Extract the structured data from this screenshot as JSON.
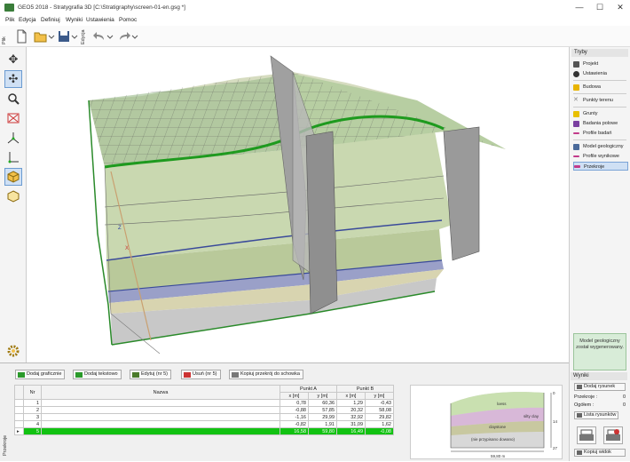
{
  "window": {
    "title": "GEO5 2018 - Stratygrafia 3D [C:\\Stratigraphy\\screen-01-en.gsg *]",
    "minimize": "—",
    "maximize": "☐",
    "close": "✕"
  },
  "menu": [
    "Plik",
    "Edycja",
    "Definiuj",
    "Wyniki",
    "Ustawienia",
    "Pomoc"
  ],
  "toolbar": {
    "tab_file": "Plik",
    "tab_edit": "Edycja"
  },
  "modes": {
    "header": "Tryby",
    "items": [
      {
        "label": "Projekt",
        "color": "#555555"
      },
      {
        "label": "Ustawienia",
        "color": "#333333"
      },
      {
        "label": "Budowa",
        "color": "#e8b400"
      },
      {
        "label": "Punkty terenu",
        "color": "#888888"
      },
      {
        "label": "Grunty",
        "color": "#e8c000"
      },
      {
        "label": "Badania polowe",
        "color": "#7a3fa0"
      },
      {
        "label": "Profile badań",
        "color": "#c23a8a"
      },
      {
        "label": "Model geologiczny",
        "color": "#4a6a9a"
      },
      {
        "label": "Profile wynikowe",
        "color": "#c23a8a"
      },
      {
        "label": "Przekroje",
        "color": "#c23a8a"
      }
    ],
    "info": "Model geologiczny został wygenerowany."
  },
  "section_panel": {
    "vertical_tab": "Przekroje",
    "buttons": {
      "add_graphic": "Dodaj graficznie",
      "add_text": "Dodaj tekstowo",
      "edit": "Edytuj (nr 5)",
      "delete": "Usuń (nr 5)",
      "copy": "Kopiuj przekrój do schowka"
    },
    "columns": {
      "nr": "Nr",
      "name": "Nazwa",
      "point_a": "Punkt A",
      "point_b": "Punkt B",
      "x": "x [m]",
      "y": "y [m]"
    },
    "rows": [
      {
        "nr": "1",
        "xa": "0,78",
        "ya": "60,36",
        "xb": "1,29",
        "yb": "-0,43"
      },
      {
        "nr": "2",
        "xa": "-0,88",
        "ya": "57,85",
        "xb": "20,32",
        "yb": "58,08"
      },
      {
        "nr": "3",
        "xa": "-1,16",
        "ya": "29,99",
        "xb": "32,92",
        "yb": "29,82"
      },
      {
        "nr": "4",
        "xa": "-0,82",
        "ya": "1,91",
        "xb": "31,09",
        "yb": "1,62"
      },
      {
        "nr": "5",
        "xa": "16,58",
        "ya": "59,80",
        "xb": "16,49",
        "yb": "-0,08"
      }
    ],
    "selected_marker": "▸"
  },
  "preview": {
    "labels": {
      "loess": "loess",
      "silty_clay": "silty clay",
      "claystone": "claystone",
      "unknown": "(nie przypisano dowano)",
      "length": "59,80 m"
    },
    "ticks": [
      "0",
      "14",
      "27"
    ]
  },
  "results": {
    "header": "Wyniki",
    "add_drawing": "Dodaj rysunek",
    "sections_label": "Przekroje :",
    "sections_value": "0",
    "total_label": "Ogółem :",
    "total_value": "0",
    "list": "Lista rysunków",
    "copy_view": "Kopiuj widok"
  },
  "viewport_axes": {
    "z": "Z",
    "x": "X"
  }
}
